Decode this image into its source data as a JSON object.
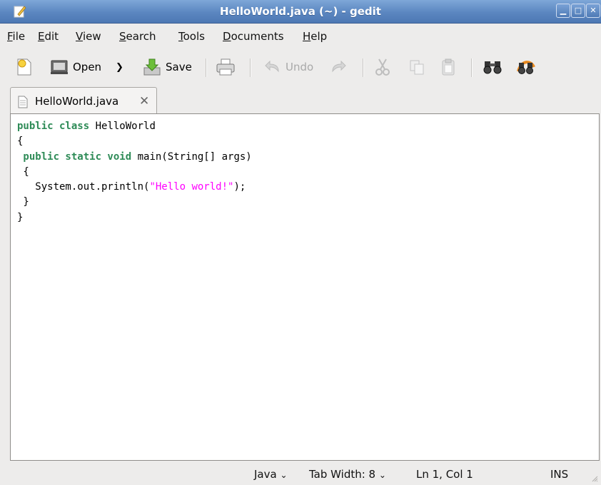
{
  "window": {
    "title": "HelloWorld.java (~) - gedit",
    "controls": [
      "minimize",
      "maximize",
      "close"
    ]
  },
  "menu": {
    "items": [
      {
        "pre": "",
        "u": "F",
        "post": "ile"
      },
      {
        "pre": "",
        "u": "E",
        "post": "dit"
      },
      {
        "pre": "",
        "u": "V",
        "post": "iew"
      },
      {
        "pre": "",
        "u": "S",
        "post": "earch"
      },
      {
        "pre": "",
        "u": "T",
        "post": "ools"
      },
      {
        "pre": "",
        "u": "D",
        "post": "ocuments"
      },
      {
        "pre": "",
        "u": "H",
        "post": "elp"
      }
    ]
  },
  "toolbar": {
    "open_label": "Open",
    "save_label": "Save",
    "undo_label": "Undo",
    "icons": [
      "new-document-icon",
      "open-icon",
      "save-icon",
      "print-icon",
      "undo-icon",
      "redo-icon",
      "cut-icon",
      "copy-icon",
      "paste-icon",
      "find-icon",
      "replace-icon"
    ]
  },
  "tab": {
    "label": "HelloWorld.java",
    "close_glyph": "✕"
  },
  "editor": {
    "lines": [
      [
        {
          "t": "public class",
          "c": "kw"
        },
        {
          "t": " HelloWorld",
          "c": ""
        }
      ],
      [
        {
          "t": "{",
          "c": ""
        }
      ],
      [
        {
          "t": " public static void",
          "c": "kw"
        },
        {
          "t": " main(String[] args)",
          "c": ""
        }
      ],
      [
        {
          "t": " {",
          "c": ""
        }
      ],
      [
        {
          "t": "   System.out.println(",
          "c": ""
        },
        {
          "t": "\"Hello world!\"",
          "c": "str"
        },
        {
          "t": ");",
          "c": ""
        }
      ],
      [
        {
          "t": " }",
          "c": ""
        }
      ],
      [
        {
          "t": "}",
          "c": ""
        }
      ]
    ]
  },
  "status": {
    "language": "Java",
    "tab_width": "Tab Width:  8",
    "cursor": "Ln 1, Col 1",
    "mode": "INS"
  },
  "colors": {
    "keyword": "#2e8b57",
    "string": "#ff00ff",
    "titlebar": "#5b86c0"
  }
}
